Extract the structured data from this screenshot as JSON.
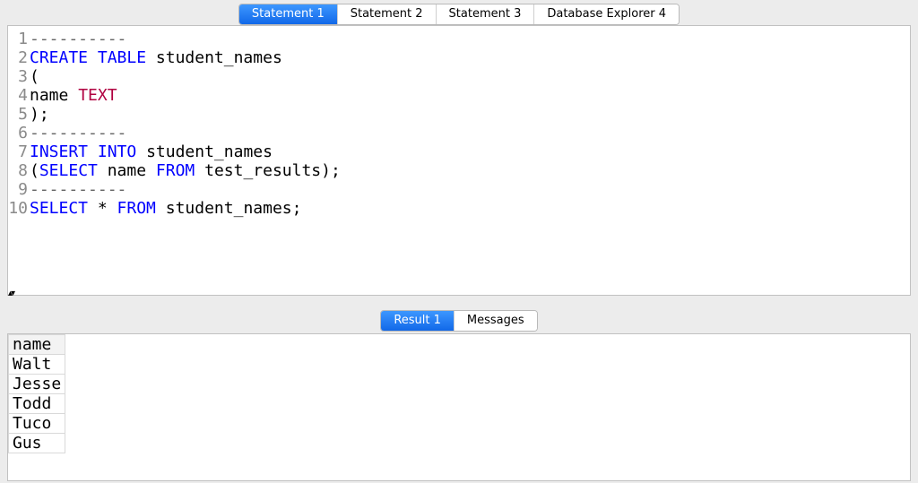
{
  "top_tabs": [
    {
      "label": "Statement 1",
      "active": true
    },
    {
      "label": "Statement 2",
      "active": false
    },
    {
      "label": "Statement 3",
      "active": false
    },
    {
      "label": "Database Explorer 4",
      "active": false
    }
  ],
  "code_lines": [
    [
      {
        "t": "----------",
        "c": "comment"
      }
    ],
    [
      {
        "t": "CREATE",
        "c": "kw"
      },
      {
        "t": " "
      },
      {
        "t": "TABLE",
        "c": "kw"
      },
      {
        "t": " student_names"
      }
    ],
    [
      {
        "t": "("
      }
    ],
    [
      {
        "t": "name "
      },
      {
        "t": "TEXT",
        "c": "type"
      }
    ],
    [
      {
        "t": ");"
      }
    ],
    [
      {
        "t": "----------",
        "c": "comment"
      }
    ],
    [
      {
        "t": "INSERT",
        "c": "kw"
      },
      {
        "t": " "
      },
      {
        "t": "INTO",
        "c": "kw"
      },
      {
        "t": " student_names"
      }
    ],
    [
      {
        "t": "("
      },
      {
        "t": "SELECT",
        "c": "kw"
      },
      {
        "t": " name "
      },
      {
        "t": "FROM",
        "c": "kw"
      },
      {
        "t": " test_results);"
      }
    ],
    [
      {
        "t": "----------",
        "c": "comment"
      }
    ],
    [
      {
        "t": "SELECT",
        "c": "kw"
      },
      {
        "t": " * "
      },
      {
        "t": "FROM",
        "c": "kw"
      },
      {
        "t": " student_names;"
      }
    ]
  ],
  "result_tabs": [
    {
      "label": "Result 1",
      "active": true
    },
    {
      "label": "Messages",
      "active": false
    }
  ],
  "result": {
    "columns": [
      "name"
    ],
    "rows": [
      [
        "Walt"
      ],
      [
        "Jesse"
      ],
      [
        "Todd"
      ],
      [
        "Tuco"
      ],
      [
        "Gus"
      ]
    ]
  },
  "sash_glyph": "▴▾"
}
